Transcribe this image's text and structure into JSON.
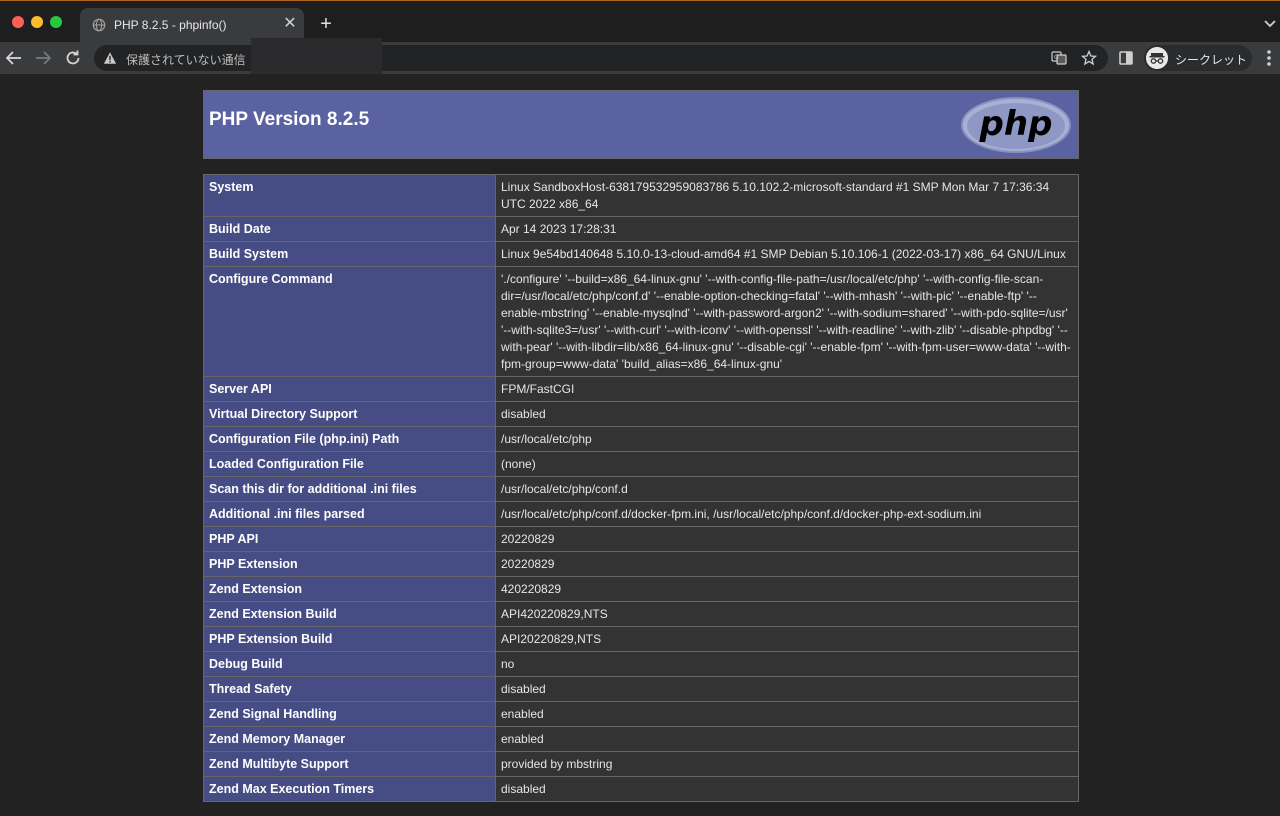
{
  "browser": {
    "tab_title": "PHP 8.2.5 - phpinfo()",
    "omnibox_text": "保護されていない通信",
    "incognito_label": "シークレット"
  },
  "php": {
    "version_title": "PHP Version 8.2.5",
    "logo_text": "php"
  },
  "colors": {
    "header_bg": "#5a62a2",
    "label_cell_bg": "#464d84",
    "value_cell_bg": "#333333",
    "page_bg": "#222222"
  },
  "rows": [
    {
      "label": "System",
      "value": "Linux SandboxHost-638179532959083786 5.10.102.2-microsoft-standard #1 SMP Mon Mar 7 17:36:34 UTC 2022 x86_64"
    },
    {
      "label": "Build Date",
      "value": "Apr 14 2023 17:28:31"
    },
    {
      "label": "Build System",
      "value": "Linux 9e54bd140648 5.10.0-13-cloud-amd64 #1 SMP Debian 5.10.106-1 (2022-03-17) x86_64 GNU/Linux"
    },
    {
      "label": "Configure Command",
      "value": "'./configure' '--build=x86_64-linux-gnu' '--with-config-file-path=/usr/local/etc/php' '--with-config-file-scan-dir=/usr/local/etc/php/conf.d' '--enable-option-checking=fatal' '--with-mhash' '--with-pic' '--enable-ftp' '--enable-mbstring' '--enable-mysqlnd' '--with-password-argon2' '--with-sodium=shared' '--with-pdo-sqlite=/usr' '--with-sqlite3=/usr' '--with-curl' '--with-iconv' '--with-openssl' '--with-readline' '--with-zlib' '--disable-phpdbg' '--with-pear' '--with-libdir=lib/x86_64-linux-gnu' '--disable-cgi' '--enable-fpm' '--with-fpm-user=www-data' '--with-fpm-group=www-data' 'build_alias=x86_64-linux-gnu'"
    },
    {
      "label": "Server API",
      "value": "FPM/FastCGI"
    },
    {
      "label": "Virtual Directory Support",
      "value": "disabled"
    },
    {
      "label": "Configuration File (php.ini) Path",
      "value": "/usr/local/etc/php"
    },
    {
      "label": "Loaded Configuration File",
      "value": "(none)"
    },
    {
      "label": "Scan this dir for additional .ini files",
      "value": "/usr/local/etc/php/conf.d"
    },
    {
      "label": "Additional .ini files parsed",
      "value": "/usr/local/etc/php/conf.d/docker-fpm.ini, /usr/local/etc/php/conf.d/docker-php-ext-sodium.ini"
    },
    {
      "label": "PHP API",
      "value": "20220829"
    },
    {
      "label": "PHP Extension",
      "value": "20220829"
    },
    {
      "label": "Zend Extension",
      "value": "420220829"
    },
    {
      "label": "Zend Extension Build",
      "value": "API420220829,NTS"
    },
    {
      "label": "PHP Extension Build",
      "value": "API20220829,NTS"
    },
    {
      "label": "Debug Build",
      "value": "no"
    },
    {
      "label": "Thread Safety",
      "value": "disabled"
    },
    {
      "label": "Zend Signal Handling",
      "value": "enabled"
    },
    {
      "label": "Zend Memory Manager",
      "value": "enabled"
    },
    {
      "label": "Zend Multibyte Support",
      "value": "provided by mbstring"
    },
    {
      "label": "Zend Max Execution Timers",
      "value": "disabled"
    }
  ]
}
